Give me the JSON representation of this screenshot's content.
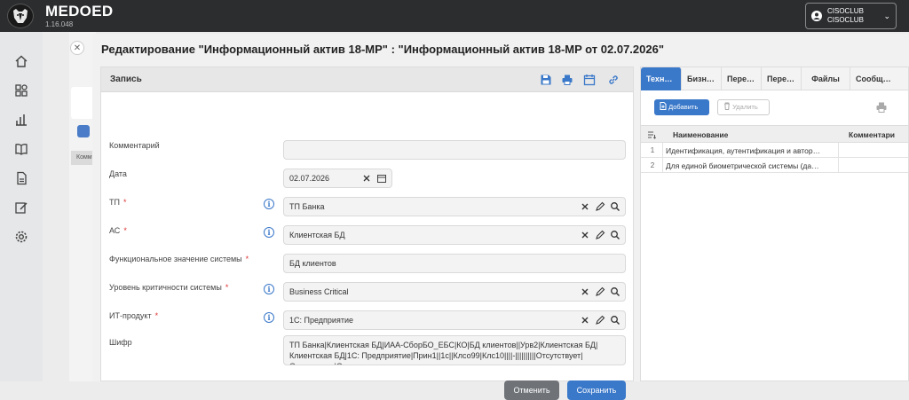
{
  "app": {
    "brand": "MEDOED",
    "version": "1.16.048",
    "user": {
      "line1": "CISOCLUB",
      "line2": "CISOCLUB"
    }
  },
  "sidebar": {
    "icons": [
      "home-icon",
      "dashboard-icon",
      "chart-icon",
      "book-icon",
      "document-icon",
      "edit-icon",
      "gear-icon"
    ]
  },
  "background": {
    "row_label": "Комм"
  },
  "modal": {
    "title": "Редактирование \"Информационный актив 18-MP\" : \"Информационный актив 18-MP от 02.07.2026\""
  },
  "record": {
    "header": "Запись",
    "fields": {
      "comment": {
        "label": "Комментарий",
        "value": ""
      },
      "date": {
        "label": "Дата",
        "value": "02.07.2026"
      },
      "tp": {
        "label": "ТП",
        "required": "*",
        "value": "ТП Банка"
      },
      "as": {
        "label": "АС",
        "required": "*",
        "value": "Клиентская БД"
      },
      "func": {
        "label": "Функциональное значение системы",
        "required": "*",
        "value": "БД клиентов"
      },
      "crit": {
        "label": "Уровень критичности системы",
        "required": "*",
        "value": "Business Critical"
      },
      "it": {
        "label": "ИТ-продукт",
        "required": "*",
        "value": "1С: Предприятие"
      },
      "cipher": {
        "label": "Шифр",
        "value": "ТП Банка|Клиентская БД|ИАА-СборБО_ЕБС|КО|БД клиентов||Урв2|Клиентская БД|Клиентская БД|1С: Предприятие|Прин1||1с||Клсо99|Клс10||||-||||||||||Отсутствует|Отсутствует|Отсутствует"
      }
    },
    "buttons": {
      "cancel": "Отменить",
      "save": "Сохранить"
    }
  },
  "right": {
    "tabs": [
      "Техн…",
      "Бизн…",
      "Пере…",
      "Пере…",
      "Файлы",
      "Сообщ…"
    ],
    "active_tab": 0,
    "add_label": "Добавить",
    "delete_label": "Удалить",
    "columns": {
      "name": "Наименование",
      "comment": "Комментари"
    },
    "rows": [
      {
        "n": "1",
        "name": "Идентификация, аутентификация и автор…"
      },
      {
        "n": "2",
        "name": "Для единой биометрической системы (да…"
      }
    ]
  },
  "colors": {
    "accent": "#3a78c9",
    "topbar": "#2b2d2f",
    "cancel": "#6f7378"
  }
}
